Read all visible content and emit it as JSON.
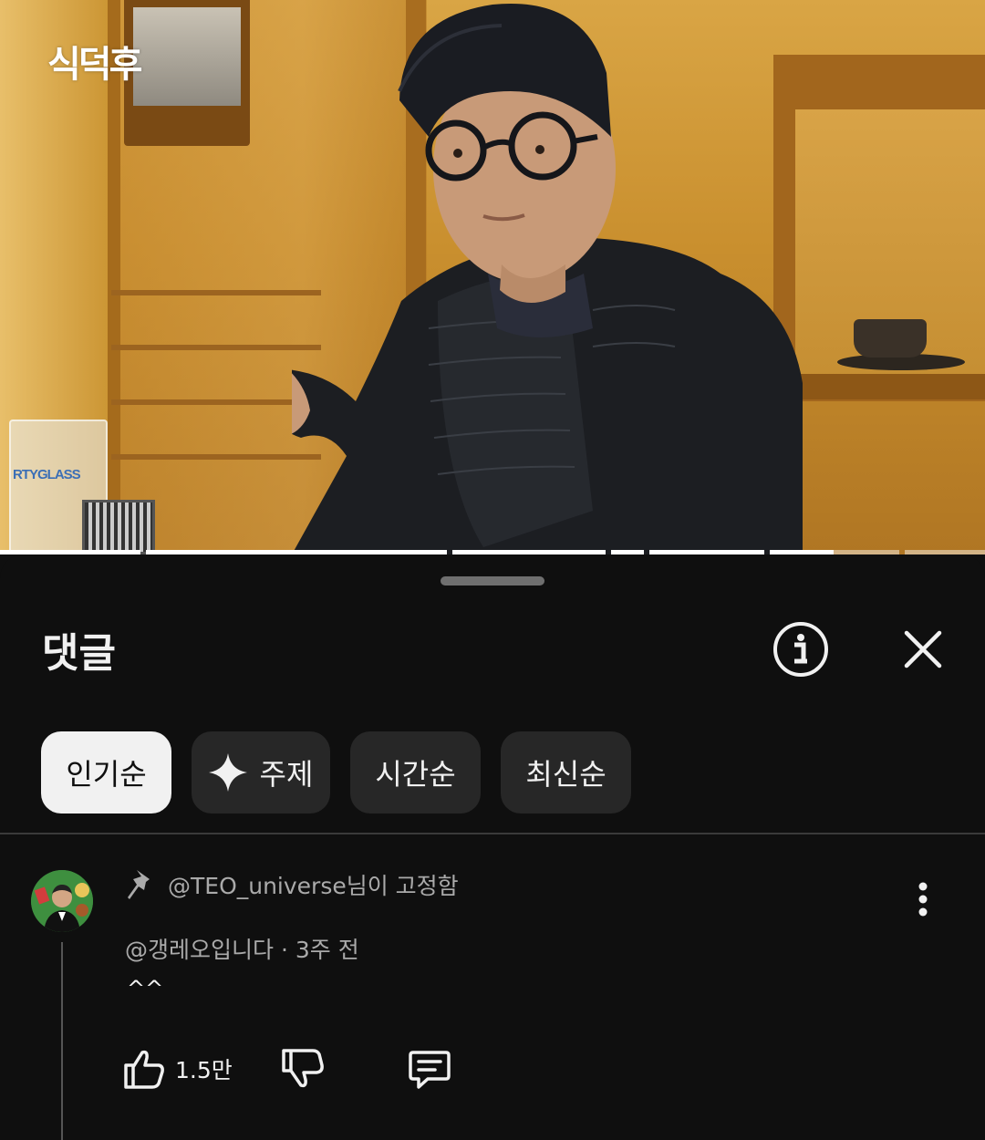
{
  "video": {
    "channel_logo": "식덕후",
    "glass_print": "RTYGLASS",
    "chapters_played_fraction": 0.85
  },
  "sheet": {
    "title": "댓글"
  },
  "chips": [
    {
      "label": "인기순",
      "active": true
    },
    {
      "label": "주제",
      "active": false,
      "icon": "sparkle-icon"
    },
    {
      "label": "시간순",
      "active": false
    },
    {
      "label": "최신순",
      "active": false
    }
  ],
  "comment": {
    "pinned_label": "@TEO_universe님이 고정함",
    "author": "@갱레오입니다",
    "time": "3주 전",
    "author_line": "@갱레오입니다 · 3주 전",
    "text": "^^",
    "likes": "1.5만"
  },
  "colors": {
    "background": "#0f0f0f",
    "chip_bg": "#272727",
    "chip_active_bg": "#f1f1f1",
    "secondary_text": "#aaaaaa"
  }
}
